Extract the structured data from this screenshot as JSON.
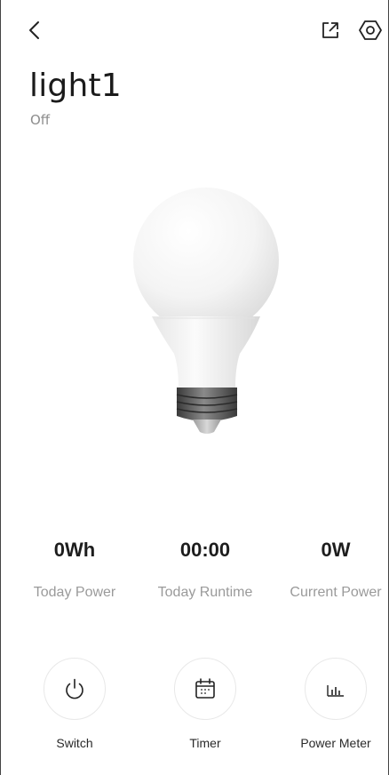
{
  "header": {
    "back_icon": "chevron-left-icon",
    "share_icon": "external-link-icon",
    "settings_icon": "hexagon-settings-icon"
  },
  "device": {
    "name": "light1",
    "status": "Off"
  },
  "stats": [
    {
      "value": "0Wh",
      "label": "Today Power"
    },
    {
      "value": "00:00",
      "label": "Today Runtime"
    },
    {
      "value": "0W",
      "label": "Current Power"
    }
  ],
  "actions": [
    {
      "label": "Switch",
      "icon": "power-icon"
    },
    {
      "label": "Timer",
      "icon": "calendar-icon"
    },
    {
      "label": "Power Meter",
      "icon": "bar-chart-icon"
    }
  ],
  "colors": {
    "background": "#ffffff",
    "text_primary": "#1f1f1f",
    "text_secondary": "#9a9a9a"
  }
}
